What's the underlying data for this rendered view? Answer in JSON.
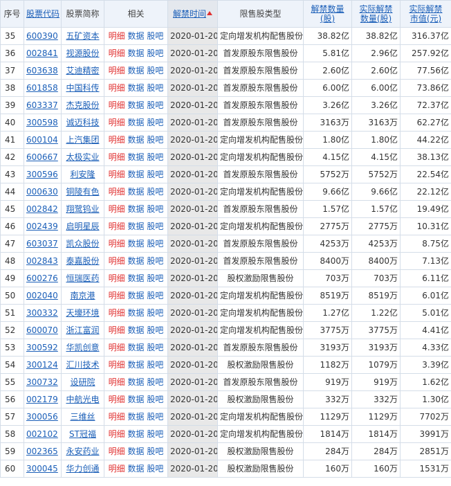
{
  "headers": {
    "idx": "序号",
    "code": "股票代码",
    "name": "股票简称",
    "rel": "相关",
    "date": "解禁时间",
    "type": "限售股类型",
    "qty1": "解禁数量",
    "qty2": "(股)",
    "act1": "实际解禁",
    "act2": "数量(股)",
    "val1": "实际解禁",
    "val2": "市值(元)"
  },
  "links": {
    "detail": "明细",
    "data": "数据",
    "bar": "股吧"
  },
  "rows": [
    {
      "idx": "35",
      "code": "600390",
      "name": "五矿资本",
      "date": "2020-01-20",
      "type": "定向增发机构配售股份",
      "qty": "38.82亿",
      "actual": "38.82亿",
      "value": "316.37亿"
    },
    {
      "idx": "36",
      "code": "002841",
      "name": "视源股份",
      "date": "2020-01-20",
      "type": "首发原股东限售股份",
      "qty": "5.81亿",
      "actual": "2.96亿",
      "value": "257.92亿"
    },
    {
      "idx": "37",
      "code": "603638",
      "name": "艾迪精密",
      "date": "2020-01-20",
      "type": "首发原股东限售股份",
      "qty": "2.60亿",
      "actual": "2.60亿",
      "value": "77.56亿"
    },
    {
      "idx": "38",
      "code": "601858",
      "name": "中国科传",
      "date": "2020-01-20",
      "type": "首发原股东限售股份",
      "qty": "6.00亿",
      "actual": "6.00亿",
      "value": "73.86亿"
    },
    {
      "idx": "39",
      "code": "603337",
      "name": "杰克股份",
      "date": "2020-01-20",
      "type": "首发原股东限售股份",
      "qty": "3.26亿",
      "actual": "3.26亿",
      "value": "72.37亿"
    },
    {
      "idx": "40",
      "code": "300598",
      "name": "诚迈科技",
      "date": "2020-01-20",
      "type": "首发原股东限售股份",
      "qty": "3163万",
      "actual": "3163万",
      "value": "62.27亿"
    },
    {
      "idx": "41",
      "code": "600104",
      "name": "上汽集团",
      "date": "2020-01-20",
      "type": "定向增发机构配售股份",
      "qty": "1.80亿",
      "actual": "1.80亿",
      "value": "44.22亿"
    },
    {
      "idx": "42",
      "code": "600667",
      "name": "太极实业",
      "date": "2020-01-20",
      "type": "定向增发机构配售股份",
      "qty": "4.15亿",
      "actual": "4.15亿",
      "value": "38.13亿"
    },
    {
      "idx": "43",
      "code": "300596",
      "name": "利安隆",
      "date": "2020-01-20",
      "type": "首发原股东限售股份",
      "qty": "5752万",
      "actual": "5752万",
      "value": "22.54亿"
    },
    {
      "idx": "44",
      "code": "000630",
      "name": "铜陵有色",
      "date": "2020-01-20",
      "type": "定向增发机构配售股份",
      "qty": "9.66亿",
      "actual": "9.66亿",
      "value": "22.12亿"
    },
    {
      "idx": "45",
      "code": "002842",
      "name": "翔鹭钨业",
      "date": "2020-01-20",
      "type": "首发原股东限售股份",
      "qty": "1.57亿",
      "actual": "1.57亿",
      "value": "19.49亿"
    },
    {
      "idx": "46",
      "code": "002439",
      "name": "启明星辰",
      "date": "2020-01-20",
      "type": "定向增发机构配售股份",
      "qty": "2775万",
      "actual": "2775万",
      "value": "10.31亿"
    },
    {
      "idx": "47",
      "code": "603037",
      "name": "凯众股份",
      "date": "2020-01-20",
      "type": "首发原股东限售股份",
      "qty": "4253万",
      "actual": "4253万",
      "value": "8.75亿"
    },
    {
      "idx": "48",
      "code": "002843",
      "name": "泰嘉股份",
      "date": "2020-01-20",
      "type": "首发原股东限售股份",
      "qty": "8400万",
      "actual": "8400万",
      "value": "7.13亿"
    },
    {
      "idx": "49",
      "code": "600276",
      "name": "恒瑞医药",
      "date": "2020-01-20",
      "type": "股权激励限售股份",
      "qty": "703万",
      "actual": "703万",
      "value": "6.11亿"
    },
    {
      "idx": "50",
      "code": "002040",
      "name": "南京港",
      "date": "2020-01-20",
      "type": "定向增发机构配售股份",
      "qty": "8519万",
      "actual": "8519万",
      "value": "6.01亿"
    },
    {
      "idx": "51",
      "code": "300332",
      "name": "天壕环境",
      "date": "2020-01-20",
      "type": "定向增发机构配售股份",
      "qty": "1.27亿",
      "actual": "1.22亿",
      "value": "5.01亿"
    },
    {
      "idx": "52",
      "code": "600070",
      "name": "浙江富润",
      "date": "2020-01-20",
      "type": "定向增发机构配售股份",
      "qty": "3775万",
      "actual": "3775万",
      "value": "4.41亿"
    },
    {
      "idx": "53",
      "code": "300592",
      "name": "华凯创意",
      "date": "2020-01-20",
      "type": "首发原股东限售股份",
      "qty": "3193万",
      "actual": "3193万",
      "value": "4.33亿"
    },
    {
      "idx": "54",
      "code": "300124",
      "name": "汇川技术",
      "date": "2020-01-20",
      "type": "股权激励限售股份",
      "qty": "1182万",
      "actual": "1079万",
      "value": "3.39亿"
    },
    {
      "idx": "55",
      "code": "300732",
      "name": "设研院",
      "date": "2020-01-20",
      "type": "首发原股东限售股份",
      "qty": "919万",
      "actual": "919万",
      "value": "1.62亿"
    },
    {
      "idx": "56",
      "code": "002179",
      "name": "中航光电",
      "date": "2020-01-20",
      "type": "股权激励限售股份",
      "qty": "332万",
      "actual": "332万",
      "value": "1.30亿"
    },
    {
      "idx": "57",
      "code": "300056",
      "name": "三维丝",
      "date": "2020-01-20",
      "type": "定向增发机构配售股份",
      "qty": "1129万",
      "actual": "1129万",
      "value": "7702万"
    },
    {
      "idx": "58",
      "code": "002102",
      "name": "ST冠福",
      "date": "2020-01-20",
      "type": "定向增发机构配售股份",
      "qty": "1814万",
      "actual": "1814万",
      "value": "3991万"
    },
    {
      "idx": "59",
      "code": "002365",
      "name": "永安药业",
      "date": "2020-01-20",
      "type": "股权激励限售股份",
      "qty": "284万",
      "actual": "284万",
      "value": "2851万"
    },
    {
      "idx": "60",
      "code": "300045",
      "name": "华力创通",
      "date": "2020-01-20",
      "type": "股权激励限售股份",
      "qty": "160万",
      "actual": "160万",
      "value": "1531万"
    }
  ]
}
